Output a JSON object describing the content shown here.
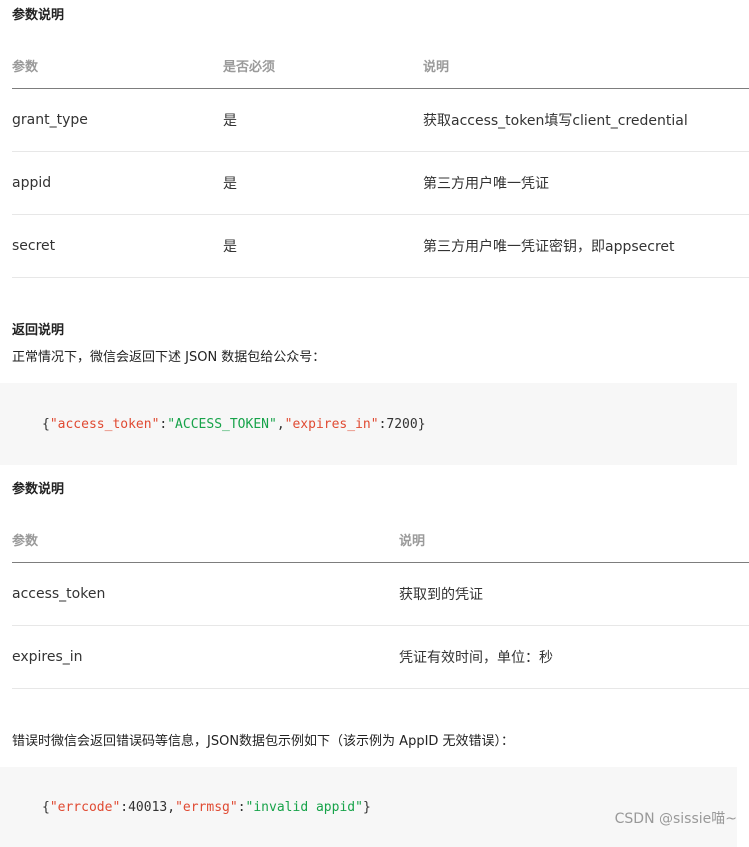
{
  "section1": {
    "title": "参数说明",
    "headers": [
      "参数",
      "是否必须",
      "说明"
    ],
    "rows": [
      [
        "grant_type",
        "是",
        "获取access_token填写client_credential"
      ],
      [
        "appid",
        "是",
        "第三方用户唯一凭证"
      ],
      [
        "secret",
        "是",
        "第三方用户唯一凭证密钥，即appsecret"
      ]
    ]
  },
  "section2": {
    "title": "返回说明",
    "desc": "正常情况下，微信会返回下述 JSON 数据包给公众号：",
    "code": {
      "open": "{",
      "k1": "\"access_token\"",
      "c1": ":",
      "v1": "\"ACCESS_TOKEN\"",
      "sep": ",",
      "k2": "\"expires_in\"",
      "c2": ":",
      "v2": "7200",
      "close": "}"
    }
  },
  "section3": {
    "title": "参数说明",
    "headers": [
      "参数",
      "说明"
    ],
    "rows": [
      [
        "access_token",
        "获取到的凭证"
      ],
      [
        "expires_in",
        "凭证有效时间，单位：秒"
      ]
    ]
  },
  "section4": {
    "desc": "错误时微信会返回错误码等信息，JSON数据包示例如下（该示例为 AppID 无效错误）：",
    "code": {
      "open": "{",
      "k1": "\"errcode\"",
      "c1": ":",
      "v1": "40013",
      "sep": ",",
      "k2": "\"errmsg\"",
      "c2": ":",
      "v2": "\"invalid appid\"",
      "close": "}"
    }
  },
  "watermark": "CSDN @sissie喵~",
  "colors": {
    "key": "#e04a32",
    "string": "#17a34a",
    "code_bg": "#f7f7f7",
    "header_text": "#9a9a9a"
  }
}
